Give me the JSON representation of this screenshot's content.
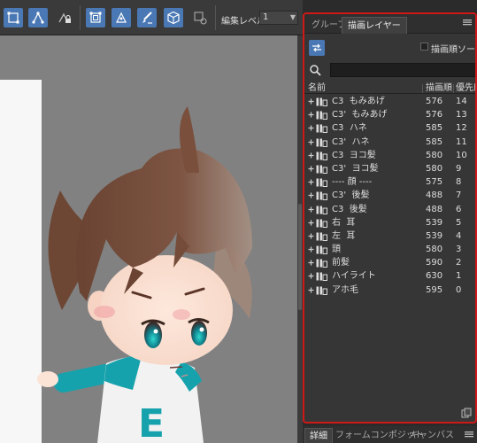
{
  "toolbar": {
    "buttons": [
      {
        "icon": "object-select-icon",
        "active": true
      },
      {
        "icon": "bone-control-icon",
        "active": true
      },
      {
        "icon": "lock-bone-icon",
        "active": false
      },
      {
        "icon": "transform-icon",
        "active": true
      },
      {
        "icon": "node-edit-icon",
        "active": true
      },
      {
        "icon": "brush-edit-icon",
        "active": true
      },
      {
        "icon": "cube-3d-icon",
        "active": true
      },
      {
        "icon": "object-transform-icon",
        "active": false
      }
    ],
    "edit_level_label": "編集レベル",
    "edit_level_value": "1"
  },
  "layer_panel": {
    "tabs": [
      "グループ",
      "描画レイヤー"
    ],
    "active_tab": "描画レイヤー",
    "draw_order_checkbox_label": "描画順ソート",
    "search_placeholder": "",
    "columns": {
      "name": "名前",
      "order": "描画順",
      "priority": "優先度"
    },
    "layers": [
      {
        "name": "C3  もみあげ",
        "order": "576",
        "priority": "14"
      },
      {
        "name": "C3'  もみあげ",
        "order": "576",
        "priority": "13"
      },
      {
        "name": "C3  ハネ",
        "order": "585",
        "priority": "12"
      },
      {
        "name": "C3'  ハネ",
        "order": "585",
        "priority": "11"
      },
      {
        "name": "C3  ヨコ髪",
        "order": "580",
        "priority": "10"
      },
      {
        "name": "C3'  ヨコ髪",
        "order": "580",
        "priority": "9"
      },
      {
        "name": "---- 顔 ----",
        "order": "575",
        "priority": "8"
      },
      {
        "name": "C3'  後髪",
        "order": "488",
        "priority": "7"
      },
      {
        "name": "C3  後髪",
        "order": "488",
        "priority": "6"
      },
      {
        "name": "右  耳",
        "order": "539",
        "priority": "5"
      },
      {
        "name": "左  耳",
        "order": "539",
        "priority": "4"
      },
      {
        "name": "頭",
        "order": "580",
        "priority": "3"
      },
      {
        "name": "前髪",
        "order": "590",
        "priority": "2"
      },
      {
        "name": "ハイライト",
        "order": "630",
        "priority": "1"
      },
      {
        "name": "アホ毛",
        "order": "595",
        "priority": "0"
      }
    ]
  },
  "bottom_tabs": [
    "詳細",
    "フォームコンポジット",
    "キャンバス"
  ],
  "colors": {
    "accent": "#4a78b4",
    "highlight_frame": "#d01818",
    "canvas_bg": "#818181",
    "panel_bg": "#363636"
  }
}
